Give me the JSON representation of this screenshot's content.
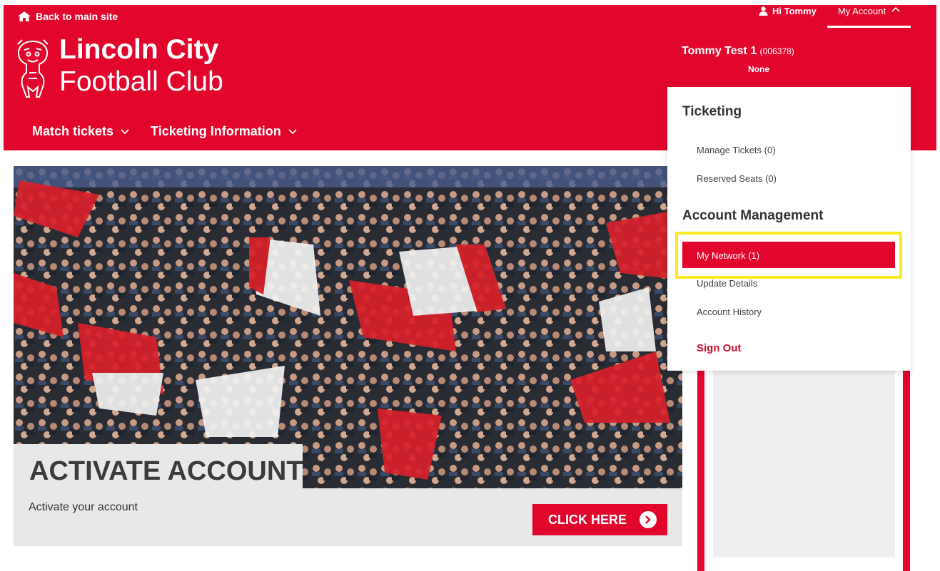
{
  "header": {
    "back_link": "Back to main site",
    "club_name_line1": "Lincoln City",
    "club_name_line2": "Football Club",
    "greeting": "Hi Tommy",
    "my_account": "My Account",
    "user_name": "Tommy Test 1",
    "user_id": "(006378)",
    "user_sub": "None"
  },
  "nav": [
    {
      "label": "Match tickets"
    },
    {
      "label": "Ticketing Information"
    }
  ],
  "dropdown": {
    "ticketing_heading": "Ticketing",
    "manage_tickets": "Manage Tickets (0)",
    "reserved_seats": "Reserved Seats (0)",
    "account_heading": "Account Management",
    "my_network": "My Network (1)",
    "update_details": "Update Details",
    "account_history": "Account History",
    "sign_out": "Sign Out"
  },
  "banner": {
    "title": "ACTIVATE ACCOUNT",
    "subtitle": "Activate your account",
    "cta": "CLICK HERE"
  },
  "colors": {
    "brand_red": "#e2062c",
    "highlight_yellow": "#fbea1b"
  },
  "icons": [
    "home-icon",
    "user-icon",
    "chevron-up-icon",
    "chevron-down-icon",
    "arrow-right-icon",
    "club-crest"
  ]
}
